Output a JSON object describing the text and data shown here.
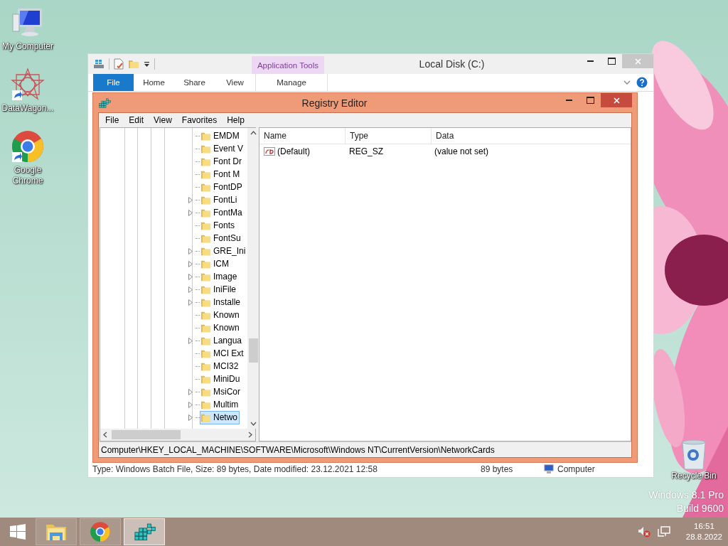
{
  "desktop_icons": [
    {
      "label": "My Computer",
      "kind": "computer"
    },
    {
      "label": "DataWagon...",
      "kind": "star"
    },
    {
      "label": "Google Chrome",
      "kind": "chrome"
    }
  ],
  "recycle_bin": {
    "label": "Recycle Bin"
  },
  "os_watermark": [
    "Windows 8.1 Pro",
    "Build 9600"
  ],
  "explorer": {
    "title": "Local Disk (C:)",
    "context_group": "Application Tools",
    "ribbon_tabs": [
      {
        "label": "File",
        "kind": "file",
        "selected": true
      },
      {
        "label": "Home",
        "kind": "tab",
        "selected": false
      },
      {
        "label": "Share",
        "kind": "tab",
        "selected": false
      },
      {
        "label": "View",
        "kind": "tab",
        "selected": false
      },
      {
        "label": "Manage",
        "kind": "context",
        "selected": false
      }
    ],
    "status_bar": {
      "details": "Type: Windows Batch File, Size: 89 bytes, Date modified: 23.12.2021 12:58",
      "size": "89 bytes",
      "location": "Computer"
    }
  },
  "registry": {
    "title": "Registry Editor",
    "menu": [
      "File",
      "Edit",
      "View",
      "Favorites",
      "Help"
    ],
    "tree": [
      {
        "label": "EMDM",
        "expandable": false,
        "selected": false
      },
      {
        "label": "Event V",
        "expandable": false,
        "selected": false
      },
      {
        "label": "Font Dr",
        "expandable": false,
        "selected": false
      },
      {
        "label": "Font M",
        "expandable": false,
        "selected": false
      },
      {
        "label": "FontDP",
        "expandable": false,
        "selected": false
      },
      {
        "label": "FontLi",
        "expandable": true,
        "selected": false
      },
      {
        "label": "FontMa",
        "expandable": true,
        "selected": false
      },
      {
        "label": "Fonts",
        "expandable": false,
        "selected": false
      },
      {
        "label": "FontSu",
        "expandable": false,
        "selected": false
      },
      {
        "label": "GRE_Ini",
        "expandable": true,
        "selected": false
      },
      {
        "label": "ICM",
        "expandable": true,
        "selected": false
      },
      {
        "label": "Image",
        "expandable": true,
        "selected": false
      },
      {
        "label": "IniFile",
        "expandable": true,
        "selected": false
      },
      {
        "label": "Installe",
        "expandable": true,
        "selected": false
      },
      {
        "label": "Known",
        "expandable": false,
        "selected": false
      },
      {
        "label": "Known",
        "expandable": false,
        "selected": false
      },
      {
        "label": "Langua",
        "expandable": true,
        "selected": false
      },
      {
        "label": "MCI Ext",
        "expandable": false,
        "selected": false
      },
      {
        "label": "MCI32",
        "expandable": false,
        "selected": false
      },
      {
        "label": "MiniDu",
        "expandable": false,
        "selected": false
      },
      {
        "label": "MsiCor",
        "expandable": true,
        "selected": false
      },
      {
        "label": "Multim",
        "expandable": true,
        "selected": false
      },
      {
        "label": "Netwo",
        "expandable": true,
        "selected": true
      }
    ],
    "columns": [
      "Name",
      "Type",
      "Data"
    ],
    "values": [
      {
        "name": "(Default)",
        "type": "REG_SZ",
        "data": "(value not set)"
      }
    ],
    "status_path": "Computer\\HKEY_LOCAL_MACHINE\\SOFTWARE\\Microsoft\\Windows NT\\CurrentVersion\\NetworkCards"
  },
  "taskbar": {
    "apps": [
      {
        "kind": "explorer",
        "selected": false
      },
      {
        "kind": "chrome",
        "selected": false
      },
      {
        "kind": "regedit",
        "selected": true
      }
    ],
    "clock": {
      "time": "16:51",
      "date": "28.8.2022"
    }
  }
}
